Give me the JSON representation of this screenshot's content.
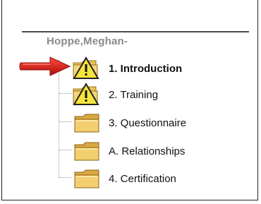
{
  "user": {
    "name": "Hoppe,Meghan-"
  },
  "tree": {
    "items": [
      {
        "label": "1. Introduction",
        "icon": "warning-folder-icon",
        "active": true
      },
      {
        "label": "2. Training",
        "icon": "warning-folder-icon",
        "active": false
      },
      {
        "label": "3. Questionnaire",
        "icon": "folder-icon",
        "active": false
      },
      {
        "label": "A. Relationships",
        "icon": "folder-icon",
        "active": false
      },
      {
        "label": "4. Certification",
        "icon": "folder-icon",
        "active": false
      }
    ]
  },
  "colors": {
    "folder_fill": "#e8c25a",
    "folder_dark": "#b8862a",
    "warning_yellow": "#f7e43a",
    "arrow_red": "#d41818"
  }
}
